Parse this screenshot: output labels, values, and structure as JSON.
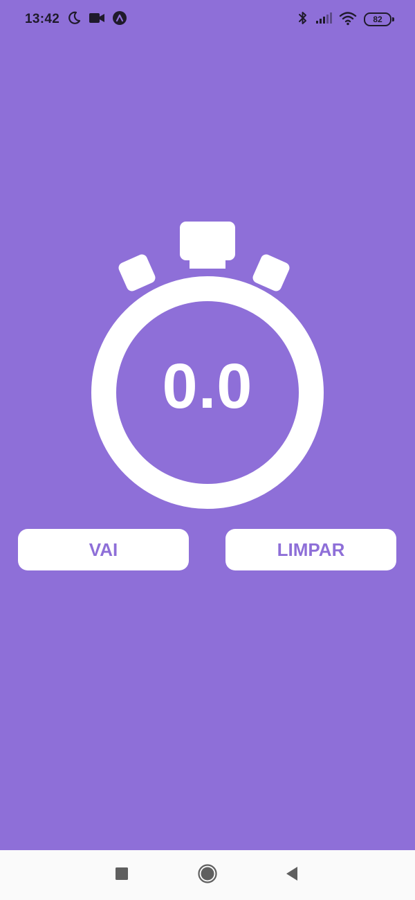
{
  "status_bar": {
    "time": "13:42",
    "battery_level": "82",
    "left_icons": [
      "moon-icon",
      "video-camera-icon",
      "app-notification-icon"
    ],
    "right_icons": [
      "bluetooth-icon",
      "signal-icon",
      "wifi-icon",
      "battery-icon"
    ]
  },
  "stopwatch": {
    "value": "0.0",
    "icon": "stopwatch-icon"
  },
  "buttons": {
    "start_label": "VAI",
    "clear_label": "LIMPAR"
  },
  "navigation_bar": {
    "items": [
      "recent-apps-icon",
      "home-icon",
      "back-icon"
    ]
  },
  "colors": {
    "background": "#8e6fd8",
    "foreground": "#ffffff",
    "nav_background": "#fafafa"
  }
}
